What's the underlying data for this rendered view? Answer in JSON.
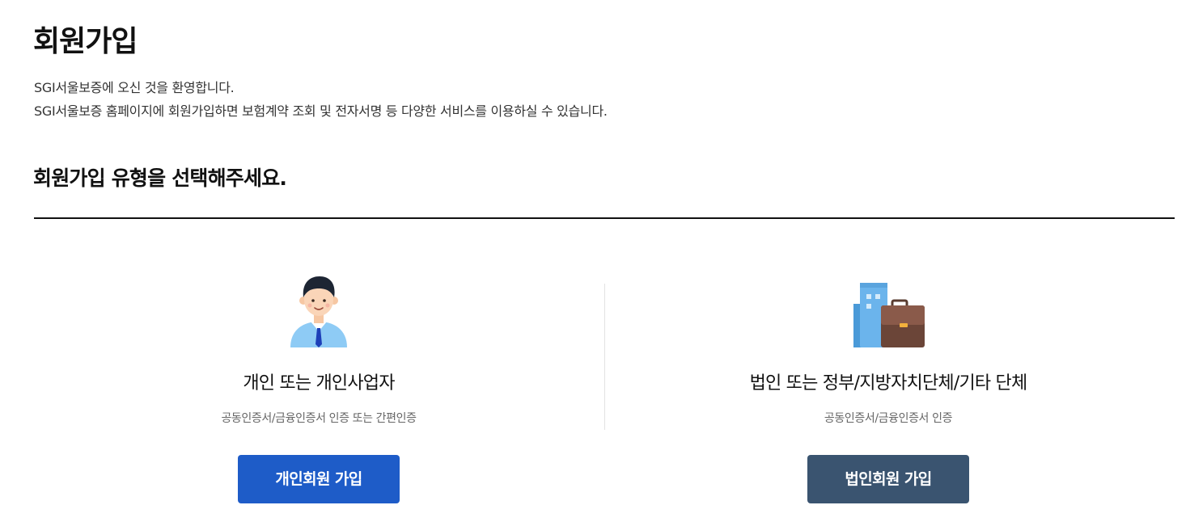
{
  "page_title": "회원가입",
  "intro": {
    "line1": "SGI서울보증에 오신 것을 환영합니다.",
    "line2": "SGI서울보증 홈페이지에 회원가입하면 보험계약 조회 및 전자서명 등 다양한 서비스를 이용하실 수 있습니다."
  },
  "section_title": "회원가입 유형을 선택해주세요.",
  "options": {
    "personal": {
      "icon": "person-icon",
      "title": "개인 또는 개인사업자",
      "description": "공동인증서/금융인증서 인증 또는 간편인증",
      "button_label": "개인회원 가입",
      "button_color": "#1e5cc8"
    },
    "corporate": {
      "icon": "building-briefcase-icon",
      "title": "법인 또는 정부/지방자치단체/기타 단체",
      "description": "공동인증서/금융인증서 인증",
      "button_label": "법인회원 가입",
      "button_color": "#3a5470"
    }
  }
}
